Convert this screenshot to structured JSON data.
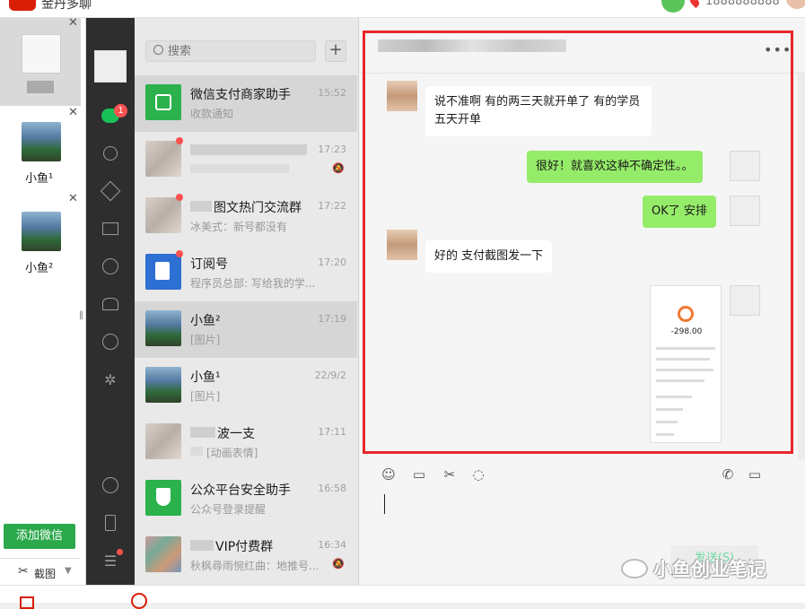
{
  "app": {
    "title": "金丹多聊",
    "top_number": "1888888888"
  },
  "accounts": {
    "items": [
      {
        "name": "小鱼¹"
      },
      {
        "name": "小鱼²"
      }
    ],
    "add_label": "添加微信",
    "screenshot_label": "截图"
  },
  "nav": {
    "badge": "1"
  },
  "search": {
    "placeholder": "搜索"
  },
  "conversations": [
    {
      "name": "微信支付商家助手",
      "preview": "收款通知",
      "time": "15:52"
    },
    {
      "name": "",
      "preview": "",
      "time": "17:23"
    },
    {
      "name": "图文热门交流群",
      "preview": "冰美式：新号都没有",
      "time": "17:22"
    },
    {
      "name": "订阅号",
      "preview": "程序员总部: 写给我的学...",
      "time": "17:20"
    },
    {
      "name": "小鱼²",
      "preview": "[图片]",
      "time": "17:19"
    },
    {
      "name": "小鱼¹",
      "preview": "[图片]",
      "time": "22/9/2"
    },
    {
      "name": "波一支",
      "preview": "[动画表情]",
      "time": "17:11"
    },
    {
      "name": "公众平台安全助手",
      "preview": "公众号登录提醒",
      "time": "16:58"
    },
    {
      "name": "VIP付费群",
      "preview": "秋枫尋雨惋红曲：地推号...",
      "time": "16:34"
    }
  ],
  "chat": {
    "messages": [
      {
        "dir": "in",
        "text": "说不准啊 有的两三天就开单了 有的学员五天开单"
      },
      {
        "dir": "out",
        "text": "很好！就喜欢这种不确定性。。"
      },
      {
        "dir": "out",
        "text": "OK了 安排"
      },
      {
        "dir": "in",
        "text": "好的 支付截图发一下"
      }
    ],
    "shot": {
      "amount": "-298.00"
    },
    "send_label": "发送(S)"
  },
  "watermark": {
    "text": "小鱼创业笔记"
  },
  "icons": {
    "emoji": "☺",
    "folder": "▭",
    "scissors": "✂",
    "chat": "◌",
    "phone": "✆",
    "video": "▭"
  },
  "colors": {
    "accent": "#07c160",
    "frame": "#e8262a",
    "badge": "#fa5151"
  }
}
